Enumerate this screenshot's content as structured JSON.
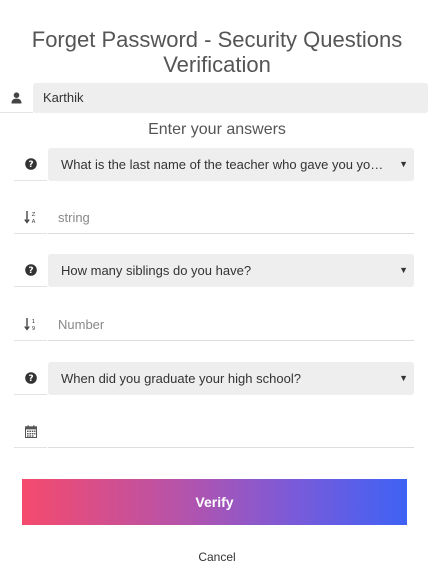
{
  "header": {
    "title_line1": "Forget Password - Security Questions",
    "title_line2": "Verification"
  },
  "user": {
    "icon": "user-icon",
    "username": "Karthik"
  },
  "subtitle": "Enter your answers",
  "questions": [
    {
      "icon": "question-circle-icon",
      "question": "What is the last name of the teacher who gave you your ...",
      "answer_icon": "sort-alpha-icon",
      "answer_placeholder": "string"
    },
    {
      "icon": "question-circle-icon",
      "question": "How many siblings do you have?",
      "answer_icon": "sort-numeric-icon",
      "answer_placeholder": "Number"
    },
    {
      "icon": "question-circle-icon",
      "question": "When did you graduate your high school?",
      "answer_icon": "calendar-icon",
      "answer_placeholder": ""
    }
  ],
  "actions": {
    "verify_label": "Verify",
    "cancel_label": "Cancel"
  },
  "colors": {
    "gradient_start": "#f54a6d",
    "gradient_end": "#3e62f5",
    "field_bg": "#eeeeee"
  }
}
